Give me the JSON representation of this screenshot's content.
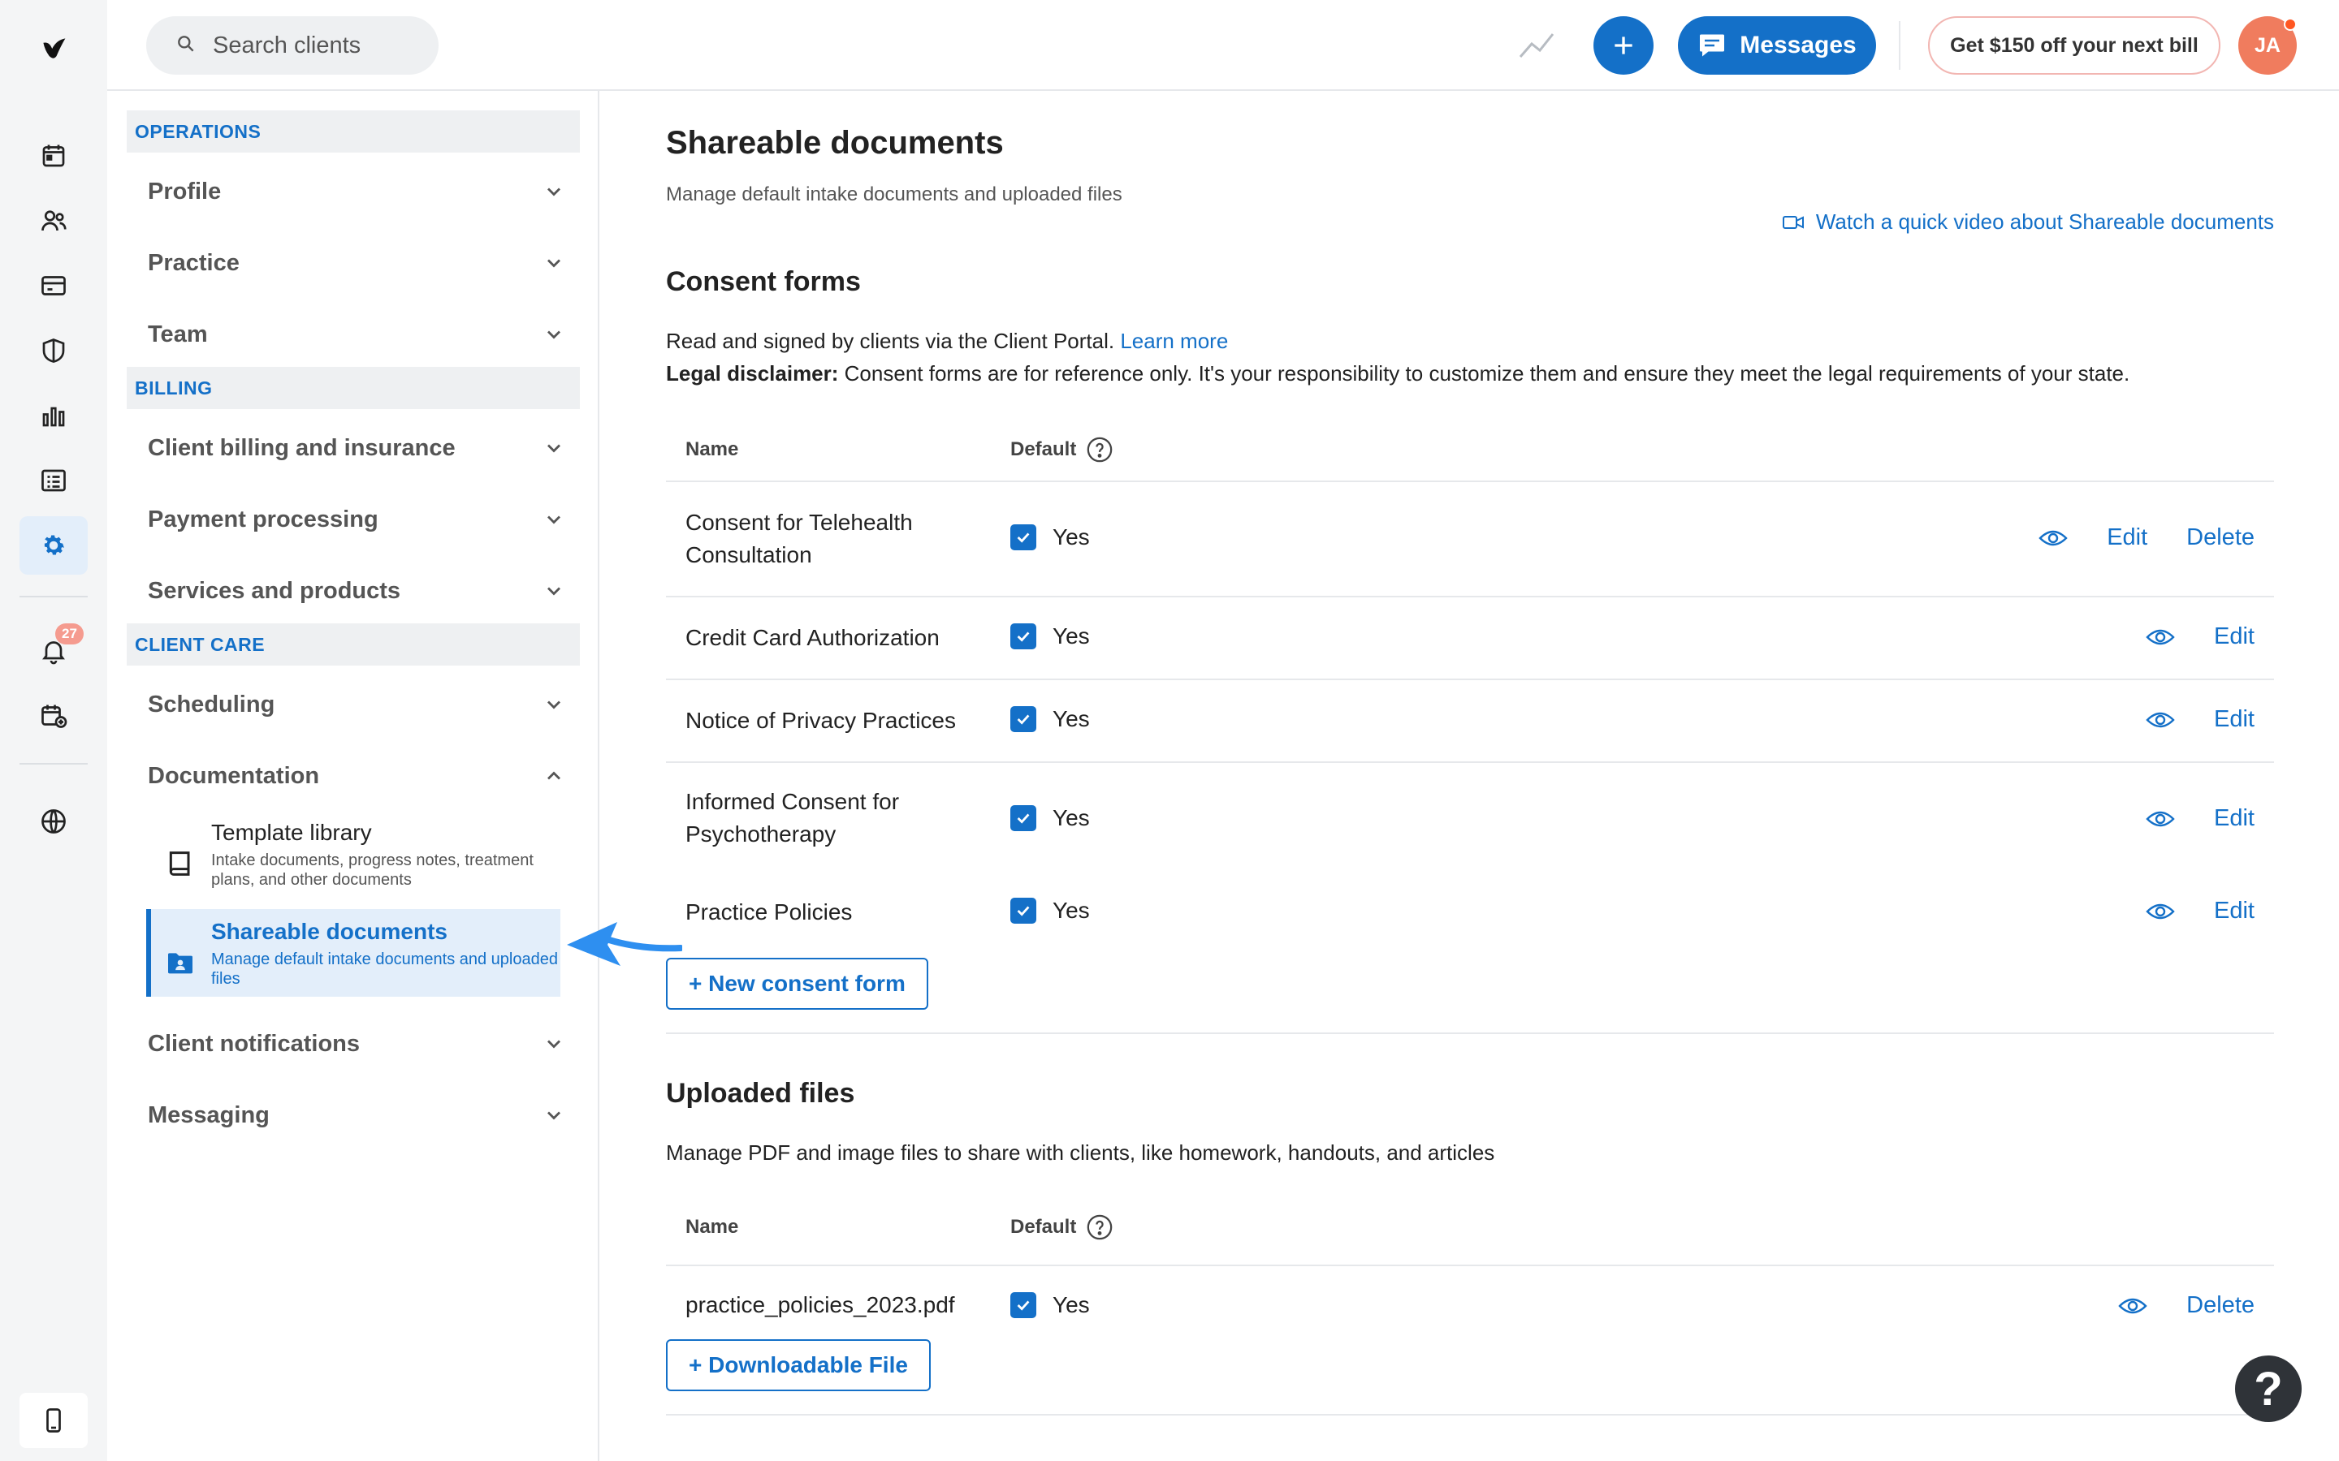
{
  "search": {
    "placeholder": "Search clients"
  },
  "topbar": {
    "messages_label": "Messages",
    "promo_label": "Get $150 off your next bill",
    "avatar_initials": "JA"
  },
  "rail": {
    "notification_count": "27"
  },
  "sidenav": {
    "sections": {
      "operations": "OPERATIONS",
      "billing": "BILLING",
      "client_care": "CLIENT CARE"
    },
    "items": {
      "profile": "Profile",
      "practice": "Practice",
      "team": "Team",
      "client_billing": "Client billing and insurance",
      "payment_processing": "Payment processing",
      "services": "Services and products",
      "scheduling": "Scheduling",
      "documentation": "Documentation",
      "client_notifications": "Client notifications",
      "messaging": "Messaging"
    },
    "subitems": {
      "template_library": {
        "title": "Template library",
        "desc": "Intake documents, progress notes, treatment plans, and other documents"
      },
      "shareable_documents": {
        "title": "Shareable documents",
        "desc": "Manage default intake documents and uploaded files"
      }
    }
  },
  "main": {
    "title": "Shareable documents",
    "subtitle": "Manage default intake documents and uploaded files",
    "video_link": "Watch a quick video about Shareable documents",
    "consent": {
      "heading": "Consent forms",
      "intro": "Read and signed by clients via the Client Portal.",
      "learn_more": "Learn more",
      "disclaimer_label": "Legal disclaimer:",
      "disclaimer_text": "Consent forms are for reference only. It's your responsibility to customize them and ensure they meet the legal requirements of your state.",
      "col_name": "Name",
      "col_default": "Default",
      "rows": [
        {
          "name": "Consent for Telehealth Consultation",
          "default": "Yes",
          "edit": "Edit",
          "delete": "Delete"
        },
        {
          "name": "Credit Card Authorization",
          "default": "Yes",
          "edit": "Edit"
        },
        {
          "name": "Notice of Privacy Practices",
          "default": "Yes",
          "edit": "Edit"
        },
        {
          "name": "Informed Consent for Psychotherapy",
          "default": "Yes",
          "edit": "Edit"
        },
        {
          "name": "Practice Policies",
          "default": "Yes",
          "edit": "Edit"
        }
      ],
      "new_button": "+ New consent form"
    },
    "uploads": {
      "heading": "Uploaded files",
      "intro": "Manage PDF and image files to share with clients, like homework, handouts, and articles",
      "col_name": "Name",
      "col_default": "Default",
      "rows": [
        {
          "name": "practice_policies_2023.pdf",
          "default": "Yes",
          "delete": "Delete"
        }
      ],
      "new_button": "+ Downloadable File"
    }
  },
  "help": {
    "label": "?"
  },
  "colors": {
    "accent": "#1470c8",
    "active_bg": "#e3eefa",
    "promo_border": "#f2b6b2",
    "avatar": "#f07c5e",
    "badge": "#f59b8f",
    "arrow": "#2e8ff0"
  }
}
